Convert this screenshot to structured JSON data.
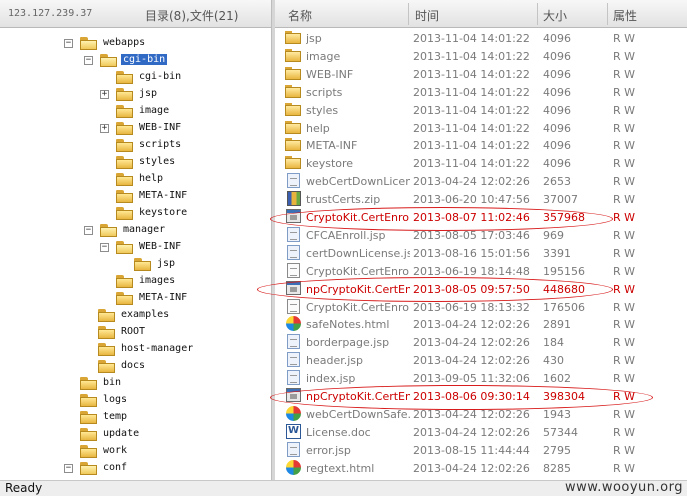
{
  "left_header": {
    "address": "123.127.239.37",
    "summary": "目录(8),文件(21)"
  },
  "columns": {
    "name": "名称",
    "time": "时间",
    "size": "大小",
    "attr": "属性"
  },
  "tree": [
    {
      "label": "webapps",
      "expander": "−",
      "open": true
    },
    {
      "label": "cgi-bin",
      "expander": "−",
      "open": true,
      "selected": true
    },
    {
      "label": "cgi-bin",
      "expander": "",
      "open": false
    },
    {
      "label": "jsp",
      "expander": "+",
      "open": false
    },
    {
      "label": "image",
      "expander": "",
      "open": false
    },
    {
      "label": "WEB-INF",
      "expander": "+",
      "open": false
    },
    {
      "label": "scripts",
      "expander": "",
      "open": false
    },
    {
      "label": "styles",
      "expander": "",
      "open": false
    },
    {
      "label": "help",
      "expander": "",
      "open": false
    },
    {
      "label": "META-INF",
      "expander": "",
      "open": false
    },
    {
      "label": "keystore",
      "expander": "",
      "open": false
    },
    {
      "label": "manager",
      "expander": "−",
      "open": true
    },
    {
      "label": "WEB-INF",
      "expander": "−",
      "open": true
    },
    {
      "label": "jsp",
      "expander": "",
      "open": false
    },
    {
      "label": "images",
      "expander": "",
      "open": false
    },
    {
      "label": "META-INF",
      "expander": "",
      "open": false
    },
    {
      "label": "examples",
      "expander": "",
      "open": false
    },
    {
      "label": "ROOT",
      "expander": "",
      "open": false
    },
    {
      "label": "host-manager",
      "expander": "",
      "open": false
    },
    {
      "label": "docs",
      "expander": "",
      "open": false
    },
    {
      "label": "bin",
      "expander": "",
      "open": false
    },
    {
      "label": "logs",
      "expander": "",
      "open": false
    },
    {
      "label": "temp",
      "expander": "",
      "open": false
    },
    {
      "label": "update",
      "expander": "",
      "open": false
    },
    {
      "label": "work",
      "expander": "",
      "open": false
    },
    {
      "label": "conf",
      "expander": "−",
      "open": true
    }
  ],
  "files": [
    {
      "name": "jsp",
      "time": "2013-11-04 14:01:22",
      "size": "4096",
      "attr": "R W",
      "icon": "folder-icon"
    },
    {
      "name": "image",
      "time": "2013-11-04 14:01:22",
      "size": "4096",
      "attr": "R W",
      "icon": "folder-icon"
    },
    {
      "name": "WEB-INF",
      "time": "2013-11-04 14:01:22",
      "size": "4096",
      "attr": "R W",
      "icon": "folder-icon"
    },
    {
      "name": "scripts",
      "time": "2013-11-04 14:01:22",
      "size": "4096",
      "attr": "R W",
      "icon": "folder-icon"
    },
    {
      "name": "styles",
      "time": "2013-11-04 14:01:22",
      "size": "4096",
      "attr": "R W",
      "icon": "folder-icon"
    },
    {
      "name": "help",
      "time": "2013-11-04 14:01:22",
      "size": "4096",
      "attr": "R W",
      "icon": "folder-icon"
    },
    {
      "name": "META-INF",
      "time": "2013-11-04 14:01:22",
      "size": "4096",
      "attr": "R W",
      "icon": "folder-icon"
    },
    {
      "name": "keystore",
      "time": "2013-11-04 14:01:22",
      "size": "4096",
      "attr": "R W",
      "icon": "folder-icon"
    },
    {
      "name": "webCertDownLicen...",
      "time": "2013-04-24 12:02:26",
      "size": "2653",
      "attr": "R W",
      "icon": "jsp-file-icon"
    },
    {
      "name": "trustCerts.zip",
      "time": "2013-06-20 10:47:56",
      "size": "37007",
      "attr": "R W",
      "icon": "zip-file-icon"
    },
    {
      "name": "CryptoKit.CertEnroll...",
      "time": "2013-08-07 11:02:46",
      "size": "357968",
      "attr": "R W",
      "icon": "binary-file-icon",
      "highlight": true
    },
    {
      "name": "CFCAEnroll.jsp",
      "time": "2013-08-05 17:03:46",
      "size": "969",
      "attr": "R W",
      "icon": "jsp-file-icon"
    },
    {
      "name": "certDownLicense.jsp",
      "time": "2013-08-16 15:01:56",
      "size": "3391",
      "attr": "R W",
      "icon": "jsp-file-icon"
    },
    {
      "name": "CryptoKit.CertEnroll...",
      "time": "2013-06-19 18:14:48",
      "size": "195156",
      "attr": "R W",
      "icon": "document-icon"
    },
    {
      "name": "npCryptoKit.CertEnr...",
      "time": "2013-08-05 09:57:50",
      "size": "448680",
      "attr": "R W",
      "icon": "binary-file-icon",
      "highlight": true
    },
    {
      "name": "CryptoKit.CertEnroll...",
      "time": "2013-06-19 18:13:32",
      "size": "176506",
      "attr": "R W",
      "icon": "document-icon"
    },
    {
      "name": "safeNotes.html",
      "time": "2013-04-24 12:02:26",
      "size": "2891",
      "attr": "R W",
      "icon": "browser-icon"
    },
    {
      "name": "borderpage.jsp",
      "time": "2013-04-24 12:02:26",
      "size": "184",
      "attr": "R W",
      "icon": "jsp-file-icon"
    },
    {
      "name": "header.jsp",
      "time": "2013-04-24 12:02:26",
      "size": "430",
      "attr": "R W",
      "icon": "jsp-file-icon"
    },
    {
      "name": "index.jsp",
      "time": "2013-09-05 11:32:06",
      "size": "1602",
      "attr": "R W",
      "icon": "jsp-file-icon"
    },
    {
      "name": "npCryptoKit.CertEnr...",
      "time": "2013-08-06 09:30:14",
      "size": "398304",
      "attr": "R W",
      "icon": "binary-file-icon",
      "highlight": true
    },
    {
      "name": "webCertDownSafe...",
      "time": "2013-04-24 12:02:26",
      "size": "1943",
      "attr": "R W",
      "icon": "browser-icon"
    },
    {
      "name": "License.doc",
      "time": "2013-04-24 12:02:26",
      "size": "57344",
      "attr": "R W",
      "icon": "word-doc-icon"
    },
    {
      "name": "error.jsp",
      "time": "2013-08-15 11:44:44",
      "size": "2795",
      "attr": "R W",
      "icon": "jsp-file-icon"
    },
    {
      "name": "regtext.html",
      "time": "2013-04-24 12:02:26",
      "size": "8285",
      "attr": "R W",
      "icon": "browser-icon"
    }
  ],
  "status": {
    "text": "Ready",
    "watermark": "www.wooyun.org"
  },
  "colors": {
    "highlight": "#cc0000",
    "selection": "#316ac5",
    "annotation": "#d81b1b"
  }
}
